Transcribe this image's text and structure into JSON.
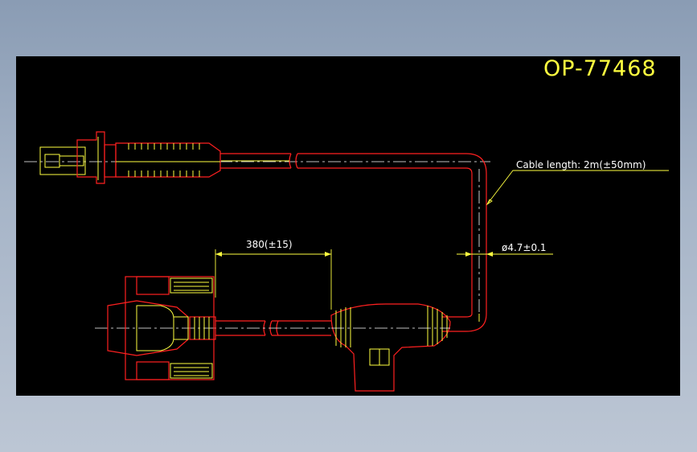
{
  "drawing": {
    "title": "OP-77468",
    "cable_length_label": "Cable length: 2m(±50mm)",
    "diameter_label": "ø4.7±0.1",
    "branch_length_label": "380(±15)"
  },
  "colors": {
    "background": "#000000",
    "outline": "#ff2020",
    "detail": "#ffff40",
    "centerline": "#ffffff"
  }
}
